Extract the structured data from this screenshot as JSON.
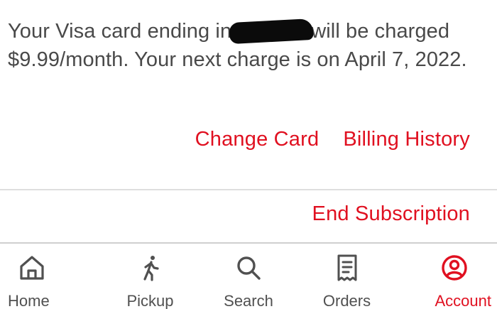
{
  "billing": {
    "text_before": "Your Visa card ending in",
    "text_after": "will be charged $9.99/month. Your next charge is on April 7, 2022."
  },
  "actions": {
    "change_card": "Change Card",
    "billing_history": "Billing History",
    "end_subscription": "End Subscription"
  },
  "tabs": [
    {
      "label": "Home",
      "icon": "home-icon"
    },
    {
      "label": "Pickup",
      "icon": "walking-person-icon"
    },
    {
      "label": "Search",
      "icon": "search-icon"
    },
    {
      "label": "Orders",
      "icon": "receipt-icon"
    },
    {
      "label": "Account",
      "icon": "account-icon",
      "active": true
    }
  ],
  "colors": {
    "accent": "#e01020",
    "text": "#494949",
    "divider": "#dedede"
  }
}
